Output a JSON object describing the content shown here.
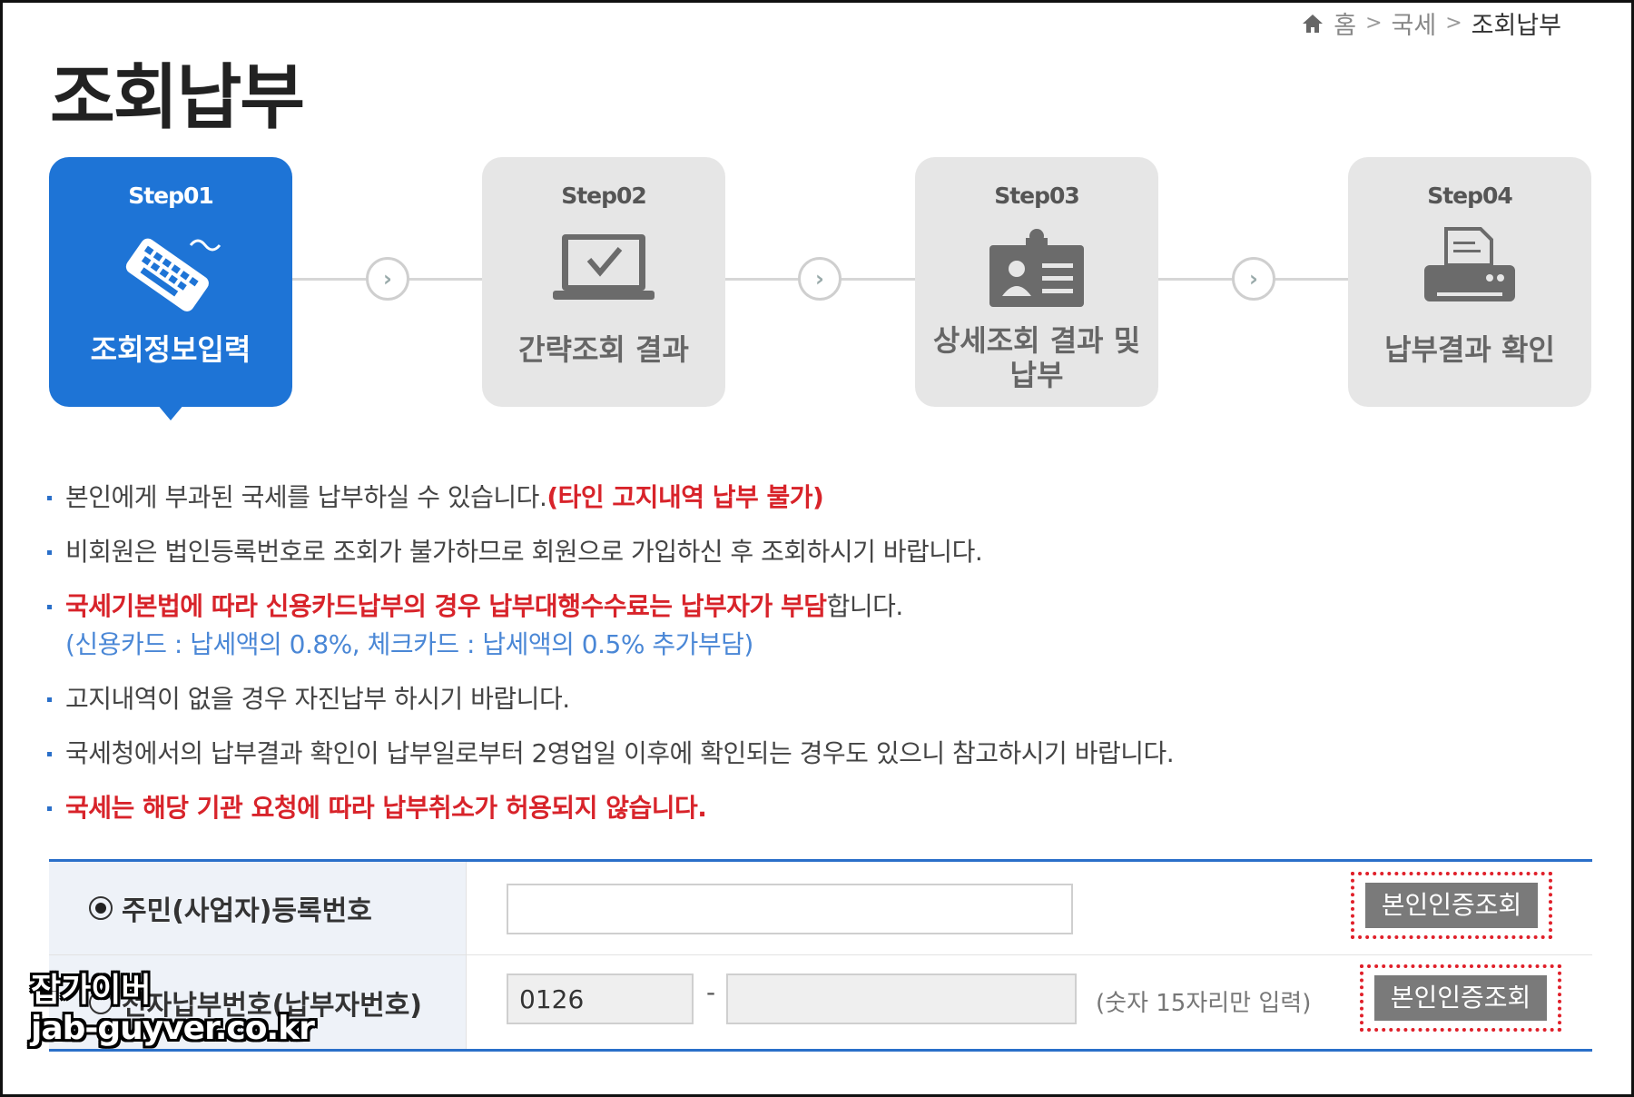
{
  "breadcrumb": {
    "home": "홈",
    "sep1": ">",
    "section": "국세",
    "sep2": ">",
    "current": "조회납부"
  },
  "page_title": "조회납부",
  "steps": [
    {
      "num": "Step01",
      "label": "조회정보입력",
      "icon": "keyboard-icon",
      "active": true
    },
    {
      "num": "Step02",
      "label": "간략조회 결과",
      "icon": "monitor-check-icon",
      "active": false
    },
    {
      "num": "Step03",
      "label": "상세조회 결과 및 납부",
      "icon": "id-card-icon",
      "active": false
    },
    {
      "num": "Step04",
      "label": "납부결과 확인",
      "icon": "printer-icon",
      "active": false
    }
  ],
  "arrow_glyph": "›",
  "notices": {
    "n1_text": "본인에게 부과된 국세를 납부하실 수 있습니다.",
    "n1_red": "(타인 고지내역 납부 불가)",
    "n2_text": "비회원은 법인등록번호로 조회가 불가하므로 회원으로 가입하신 후 조회하시기 바랍니다.",
    "n3_red": "국세기본법에 따라 신용카드납부의 경우 납부대행수수료는 납부자가 부담",
    "n3_text": "합니다.",
    "n3_sub": "(신용카드 : 납세액의 0.8%, 체크카드 : 납세액의 0.5% 추가부담)",
    "n4_text": "고지내역이 없을 경우 자진납부 하시기 바랍니다.",
    "n5_text": "국세청에서의 납부결과 확인이 납부일로부터 2영업일 이후에 확인되는 경우도 있으니 참고하시기 바랍니다.",
    "n6_red": "국세는 해당 기관 요청에 따라 납부취소가 허용되지 않습니다."
  },
  "form": {
    "row1": {
      "label": "주민(사업자)등록번호",
      "selected": true,
      "value": "",
      "button": "본인인증조회"
    },
    "row2": {
      "label": "전자납부번호(납부자번호)",
      "selected": false,
      "prefix_value": "0126",
      "dash": "-",
      "value": "",
      "hint": "(숫자 15자리만 입력)",
      "button": "본인인증조회"
    }
  },
  "watermark": {
    "line1": "잡가이버",
    "line2": "jab-guyver.co.kr"
  },
  "colors": {
    "accent": "#1e74d6",
    "red": "#d8232a",
    "sub_blue": "#4a87d6",
    "step_inactive": "#e6e6e6",
    "button": "#7a7a7a"
  }
}
